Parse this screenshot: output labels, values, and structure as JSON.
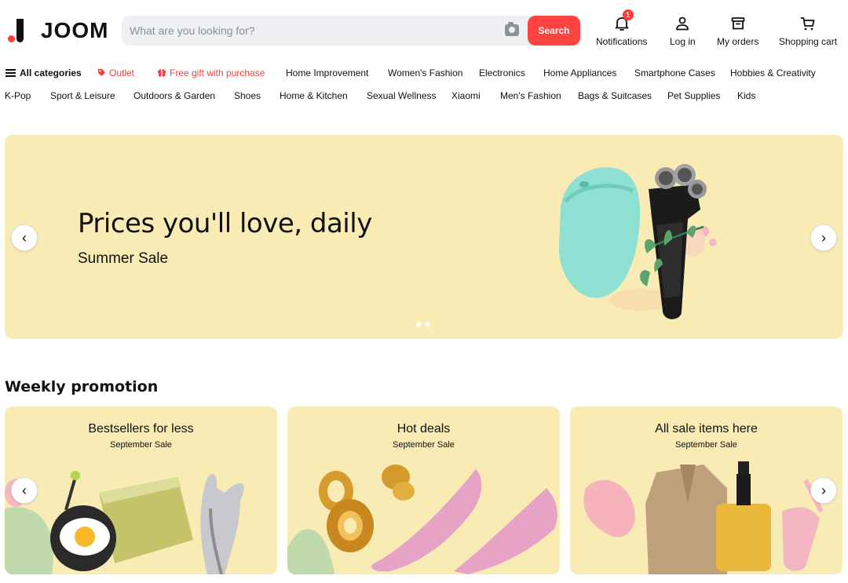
{
  "header": {
    "logo_text": "JOOM",
    "search_placeholder": "What are you looking for?",
    "search_button": "Search",
    "notifications_label": "Notifications",
    "notifications_count": "1",
    "login_label": "Log in",
    "orders_label": "My orders",
    "cart_label": "Shopping cart"
  },
  "nav": {
    "row1": [
      "All categories",
      "Outlet",
      "Free gift with purchase",
      "Home Improvement",
      "Women's Fashion",
      "Electronics",
      "Home Appliances",
      "Smartphone Cases",
      "Hobbies & Creativity"
    ],
    "row2": [
      "K-Pop",
      "Sport & Leisure",
      "Outdoors & Garden",
      "Shoes",
      "Home & Kitchen",
      "Sexual Wellness",
      "Xiaomi",
      "Men's Fashion",
      "Bags & Suitcases",
      "Pet Supplies",
      "Kids"
    ]
  },
  "hero": {
    "title": "Prices you'll love, daily",
    "subtitle": "Summer Sale",
    "slide_count": 2,
    "active_slide": 2
  },
  "weekly": {
    "title": "Weekly promotion",
    "cards": [
      {
        "title": "Bestsellers for less",
        "subtitle": "September Sale"
      },
      {
        "title": "Hot deals",
        "subtitle": "September Sale"
      },
      {
        "title": "All sale items here",
        "subtitle": "September Sale"
      }
    ]
  },
  "colors": {
    "accent": "#ff4343",
    "banner": "#f8ecb4",
    "search_bg": "#eef0f3"
  }
}
